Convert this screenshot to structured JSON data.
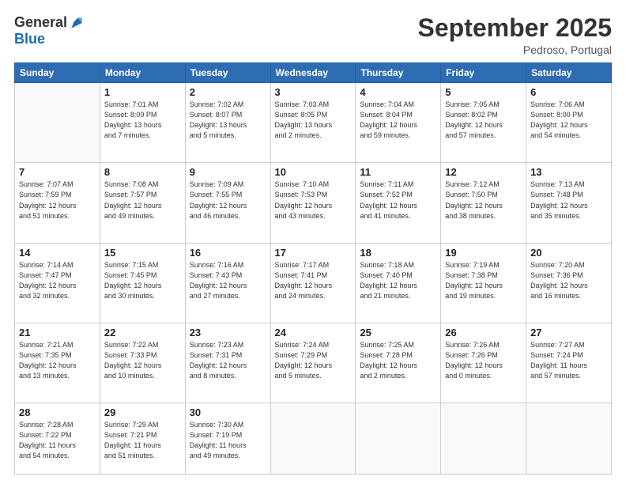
{
  "logo": {
    "general": "General",
    "blue": "Blue"
  },
  "header": {
    "month": "September 2025",
    "location": "Pedroso, Portugal"
  },
  "days_of_week": [
    "Sunday",
    "Monday",
    "Tuesday",
    "Wednesday",
    "Thursday",
    "Friday",
    "Saturday"
  ],
  "weeks": [
    [
      {
        "day": "",
        "info": ""
      },
      {
        "day": "1",
        "info": "Sunrise: 7:01 AM\nSunset: 8:09 PM\nDaylight: 13 hours\nand 7 minutes."
      },
      {
        "day": "2",
        "info": "Sunrise: 7:02 AM\nSunset: 8:07 PM\nDaylight: 13 hours\nand 5 minutes."
      },
      {
        "day": "3",
        "info": "Sunrise: 7:03 AM\nSunset: 8:05 PM\nDaylight: 13 hours\nand 2 minutes."
      },
      {
        "day": "4",
        "info": "Sunrise: 7:04 AM\nSunset: 8:04 PM\nDaylight: 12 hours\nand 59 minutes."
      },
      {
        "day": "5",
        "info": "Sunrise: 7:05 AM\nSunset: 8:02 PM\nDaylight: 12 hours\nand 57 minutes."
      },
      {
        "day": "6",
        "info": "Sunrise: 7:06 AM\nSunset: 8:00 PM\nDaylight: 12 hours\nand 54 minutes."
      }
    ],
    [
      {
        "day": "7",
        "info": "Sunrise: 7:07 AM\nSunset: 7:59 PM\nDaylight: 12 hours\nand 51 minutes."
      },
      {
        "day": "8",
        "info": "Sunrise: 7:08 AM\nSunset: 7:57 PM\nDaylight: 12 hours\nand 49 minutes."
      },
      {
        "day": "9",
        "info": "Sunrise: 7:09 AM\nSunset: 7:55 PM\nDaylight: 12 hours\nand 46 minutes."
      },
      {
        "day": "10",
        "info": "Sunrise: 7:10 AM\nSunset: 7:53 PM\nDaylight: 12 hours\nand 43 minutes."
      },
      {
        "day": "11",
        "info": "Sunrise: 7:11 AM\nSunset: 7:52 PM\nDaylight: 12 hours\nand 41 minutes."
      },
      {
        "day": "12",
        "info": "Sunrise: 7:12 AM\nSunset: 7:50 PM\nDaylight: 12 hours\nand 38 minutes."
      },
      {
        "day": "13",
        "info": "Sunrise: 7:13 AM\nSunset: 7:48 PM\nDaylight: 12 hours\nand 35 minutes."
      }
    ],
    [
      {
        "day": "14",
        "info": "Sunrise: 7:14 AM\nSunset: 7:47 PM\nDaylight: 12 hours\nand 32 minutes."
      },
      {
        "day": "15",
        "info": "Sunrise: 7:15 AM\nSunset: 7:45 PM\nDaylight: 12 hours\nand 30 minutes."
      },
      {
        "day": "16",
        "info": "Sunrise: 7:16 AM\nSunset: 7:43 PM\nDaylight: 12 hours\nand 27 minutes."
      },
      {
        "day": "17",
        "info": "Sunrise: 7:17 AM\nSunset: 7:41 PM\nDaylight: 12 hours\nand 24 minutes."
      },
      {
        "day": "18",
        "info": "Sunrise: 7:18 AM\nSunset: 7:40 PM\nDaylight: 12 hours\nand 21 minutes."
      },
      {
        "day": "19",
        "info": "Sunrise: 7:19 AM\nSunset: 7:38 PM\nDaylight: 12 hours\nand 19 minutes."
      },
      {
        "day": "20",
        "info": "Sunrise: 7:20 AM\nSunset: 7:36 PM\nDaylight: 12 hours\nand 16 minutes."
      }
    ],
    [
      {
        "day": "21",
        "info": "Sunrise: 7:21 AM\nSunset: 7:35 PM\nDaylight: 12 hours\nand 13 minutes."
      },
      {
        "day": "22",
        "info": "Sunrise: 7:22 AM\nSunset: 7:33 PM\nDaylight: 12 hours\nand 10 minutes."
      },
      {
        "day": "23",
        "info": "Sunrise: 7:23 AM\nSunset: 7:31 PM\nDaylight: 12 hours\nand 8 minutes."
      },
      {
        "day": "24",
        "info": "Sunrise: 7:24 AM\nSunset: 7:29 PM\nDaylight: 12 hours\nand 5 minutes."
      },
      {
        "day": "25",
        "info": "Sunrise: 7:25 AM\nSunset: 7:28 PM\nDaylight: 12 hours\nand 2 minutes."
      },
      {
        "day": "26",
        "info": "Sunrise: 7:26 AM\nSunset: 7:26 PM\nDaylight: 12 hours\nand 0 minutes."
      },
      {
        "day": "27",
        "info": "Sunrise: 7:27 AM\nSunset: 7:24 PM\nDaylight: 11 hours\nand 57 minutes."
      }
    ],
    [
      {
        "day": "28",
        "info": "Sunrise: 7:28 AM\nSunset: 7:22 PM\nDaylight: 11 hours\nand 54 minutes."
      },
      {
        "day": "29",
        "info": "Sunrise: 7:29 AM\nSunset: 7:21 PM\nDaylight: 11 hours\nand 51 minutes."
      },
      {
        "day": "30",
        "info": "Sunrise: 7:30 AM\nSunset: 7:19 PM\nDaylight: 11 hours\nand 49 minutes."
      },
      {
        "day": "",
        "info": ""
      },
      {
        "day": "",
        "info": ""
      },
      {
        "day": "",
        "info": ""
      },
      {
        "day": "",
        "info": ""
      }
    ]
  ]
}
